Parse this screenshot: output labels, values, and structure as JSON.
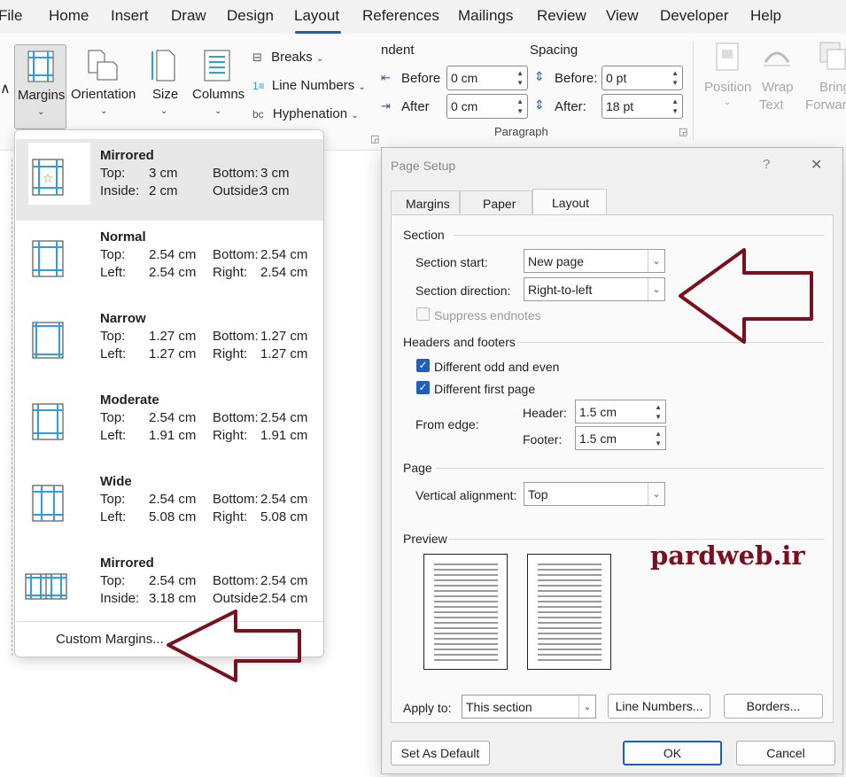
{
  "menubar": {
    "items": [
      "File",
      "Home",
      "Insert",
      "Draw",
      "Design",
      "Layout",
      "References",
      "Mailings",
      "Review",
      "View",
      "Developer",
      "Help"
    ]
  },
  "ribbon": {
    "margins": "Margins",
    "orientation": "Orientation",
    "size": "Size",
    "columns": "Columns",
    "breaks": "Breaks",
    "line_numbers": "Line Numbers",
    "hyphenation": "Hyphenation",
    "indent_header": "ndent",
    "spacing_header": "Spacing",
    "before_label": "Before",
    "after_label": "After",
    "indent_before": "0 cm",
    "indent_after": "0 cm",
    "sp_before_label": "Before:",
    "sp_after_label": "After:",
    "sp_before": "0 pt",
    "sp_after": "18 pt",
    "paragraph": "Paragraph",
    "position": "Position",
    "wrap_text_1": "Wrap",
    "wrap_text_2": "Text",
    "bring_1": "Bring",
    "bring_2": "Forwar"
  },
  "margins_menu": {
    "options": [
      {
        "title": "Mirrored",
        "r1": [
          "Top:",
          "3 cm",
          "Bottom:",
          "3 cm"
        ],
        "r2": [
          "Inside:",
          "2 cm",
          "Outside:",
          "3 cm"
        ]
      },
      {
        "title": "Normal",
        "r1": [
          "Top:",
          "2.54 cm",
          "Bottom:",
          "2.54 cm"
        ],
        "r2": [
          "Left:",
          "2.54 cm",
          "Right:",
          "2.54 cm"
        ]
      },
      {
        "title": "Narrow",
        "r1": [
          "Top:",
          "1.27 cm",
          "Bottom:",
          "1.27 cm"
        ],
        "r2": [
          "Left:",
          "1.27 cm",
          "Right:",
          "1.27 cm"
        ]
      },
      {
        "title": "Moderate",
        "r1": [
          "Top:",
          "2.54 cm",
          "Bottom:",
          "2.54 cm"
        ],
        "r2": [
          "Left:",
          "1.91 cm",
          "Right:",
          "1.91 cm"
        ]
      },
      {
        "title": "Wide",
        "r1": [
          "Top:",
          "2.54 cm",
          "Bottom:",
          "2.54 cm"
        ],
        "r2": [
          "Left:",
          "5.08 cm",
          "Right:",
          "5.08 cm"
        ]
      },
      {
        "title": "Mirrored",
        "r1": [
          "Top:",
          "2.54 cm",
          "Bottom:",
          "2.54 cm"
        ],
        "r2": [
          "Inside:",
          "3.18 cm",
          "Outside:",
          "2.54 cm"
        ]
      }
    ],
    "custom": "Custom Margins..."
  },
  "dialog": {
    "title": "Page Setup",
    "help": "?",
    "close": "✕",
    "tabs": [
      "Margins",
      "Paper",
      "Layout"
    ],
    "section_group": "Section",
    "section_start_label": "Section start:",
    "section_start": "New page",
    "section_direction_label": "Section direction:",
    "section_direction": "Right-to-left",
    "suppress_endnotes": "Suppress endnotes",
    "hf_group": "Headers and footers",
    "diff_odd_even": "Different odd and even",
    "diff_first": "Different first page",
    "from_edge": "From edge:",
    "header_label": "Header:",
    "header_val": "1.5 cm",
    "footer_label": "Footer:",
    "footer_val": "1.5 cm",
    "page_group": "Page",
    "valign_label": "Vertical alignment:",
    "valign": "Top",
    "preview_group": "Preview",
    "watermark": "pardweb.ir",
    "apply_to_label": "Apply to:",
    "apply_to": "This section",
    "line_numbers_btn": "Line Numbers...",
    "borders_btn": "Borders...",
    "set_default": "Set As Default",
    "ok": "OK",
    "cancel": "Cancel"
  },
  "colors": {
    "arrow": "#7a0f1e",
    "accent": "#1f5fb4",
    "margin_blue": "#2f9ee0"
  }
}
